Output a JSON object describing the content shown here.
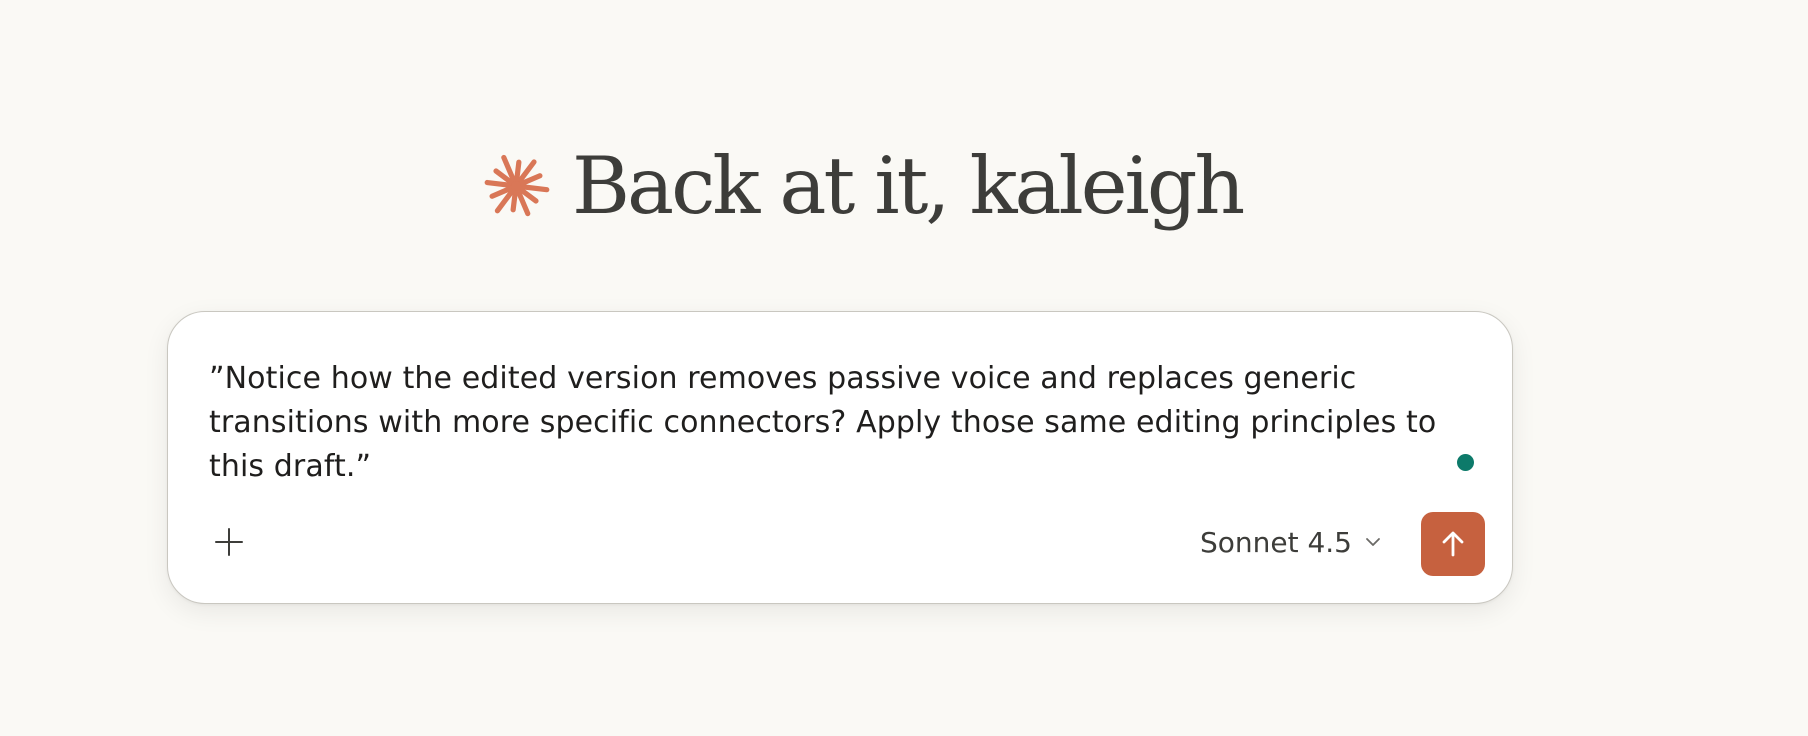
{
  "greeting": {
    "text": "Back at it, kaleigh",
    "logo_icon": "spark-asterisk-icon"
  },
  "composer": {
    "input_value": "”Notice how the edited version removes passive voice and replaces generic transitions with more specific connectors? Apply those same editing principles to this draft.”",
    "add_icon": "plus-icon",
    "status_indicator": "green-dot",
    "model_selector": {
      "label": "Sonnet 4.5",
      "icon": "chevron-down-icon"
    },
    "send_icon": "arrow-up-icon"
  },
  "colors": {
    "background": "#faf9f5",
    "accent": "#c6613f",
    "logo": "#d97757",
    "text_dark": "#3d3d3a",
    "status_dot": "#0d7a6a"
  }
}
